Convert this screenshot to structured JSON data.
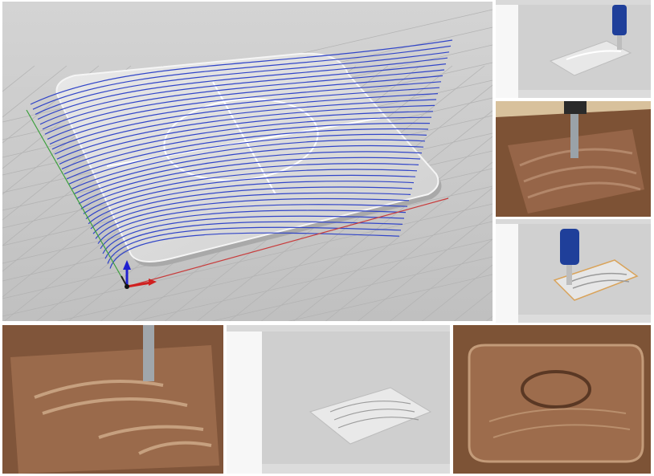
{
  "collage": {
    "tiles": [
      {
        "name": "toolpath-3d-view",
        "kind": "render"
      },
      {
        "name": "cam-software-bit-top",
        "kind": "software"
      },
      {
        "name": "cnc-bit-in-wood-top",
        "kind": "photo"
      },
      {
        "name": "cam-software-bit-mid",
        "kind": "software"
      },
      {
        "name": "carved-wood-curves",
        "kind": "photo"
      },
      {
        "name": "cam-software-simulation",
        "kind": "software"
      },
      {
        "name": "carved-wood-circle",
        "kind": "photo"
      }
    ]
  },
  "colors": {
    "toolpath": "#3246c8",
    "x_axis": "#c83c3c",
    "y_axis": "#3ca03c",
    "z_axis": "#2020d0",
    "viewport_bg": "#c9c9c9",
    "wood": "#8a5a3c",
    "bit": "#1f3f9a"
  },
  "icons": {
    "axis_gizmo": "xyz-axis-gizmo-icon"
  }
}
